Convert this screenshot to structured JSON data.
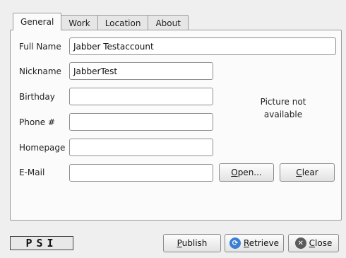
{
  "tabs": [
    "General",
    "Work",
    "Location",
    "About"
  ],
  "active_tab": "General",
  "form": {
    "full_name": {
      "label": "Full Name",
      "value": "Jabber Testaccount"
    },
    "nickname": {
      "label": "Nickname",
      "value": "JabberTest"
    },
    "birthday": {
      "label": "Birthday",
      "value": ""
    },
    "phone": {
      "label": "Phone #",
      "value": ""
    },
    "homepage": {
      "label": "Homepage",
      "value": ""
    },
    "email": {
      "label": "E-Mail",
      "value": ""
    }
  },
  "picture": {
    "line1": "Picture not",
    "line2": "available"
  },
  "picture_buttons": {
    "open": "Open...",
    "clear": "Clear"
  },
  "footer": {
    "logo": "PSI",
    "publish": "Publish",
    "retrieve": "Retrieve",
    "close": "Close",
    "retrieve_icon_color": "#3b7fd4",
    "close_icon_color": "#5a5a5a"
  }
}
